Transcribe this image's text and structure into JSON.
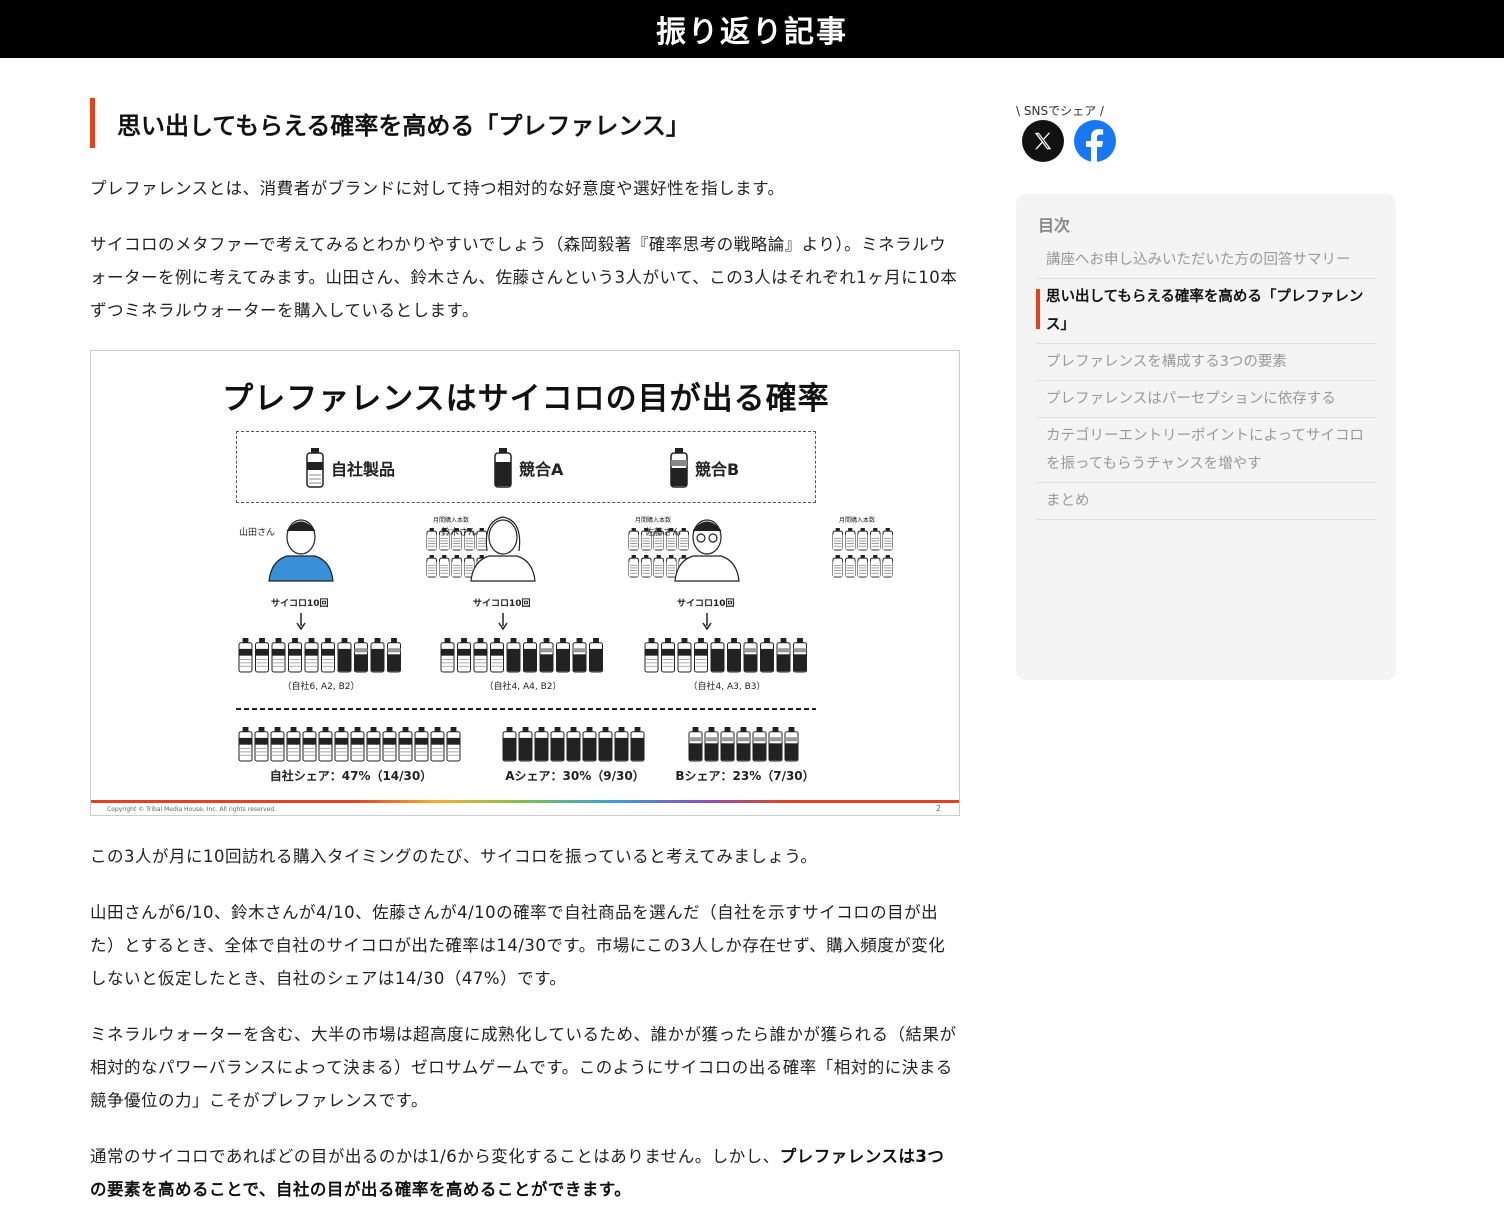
{
  "header": {
    "title": "振り返り記事"
  },
  "article": {
    "heading": "思い出してもらえる確率を高める「プレファレンス」",
    "p1": "プレファレンスとは、消費者がブランドに対して持つ相対的な好意度や選好性を指します。",
    "p2": "サイコロのメタファーで考えてみるとわかりやすいでしょう（森岡毅著『確率思考の戦略論』より）。ミネラルウォーターを例に考えてみます。山田さん、鈴木さん、佐藤さんという3人がいて、この3人はそれぞれ1ヶ月に10本ずつミネラルウォーターを購入しているとします。",
    "p3": "この3人が月に10回訪れる購入タイミングのたび、サイコロを振っていると考えてみましょう。",
    "p4": "山田さんが6/10、鈴木さんが4/10、佐藤さんが4/10の確率で自社商品を選んだ（自社を示すサイコロの目が出た）とするとき、全体で自社のサイコロが出た確率は14/30です。市場にこの3人しか存在せず、購入頻度が変化しないと仮定したとき、自社のシェアは14/30（47%）です。",
    "p5": "ミネラルウォーターを含む、大半の市場は超高度に成熟化しているため、誰かが獲ったら誰かが獲られる（結果が相対的なパワーバランスによって決まる）ゼロサムゲームです。このようにサイコロの出る確率「相対的に決まる競争優位の力」こそがプレファレンスです。",
    "p6_plain": "通常のサイコロであればどの目が出るのかは1/6から変化することはありません。しかし、",
    "p6_bold": "プレファレンスは3つの要素を高めることで、自社の目が出る確率を高めることができます。"
  },
  "figure": {
    "title": "プレファレンスはサイコロの目が出る確率",
    "legend": [
      "自社製品",
      "競合A",
      "競合B"
    ],
    "monthly_label": "月間購入本数",
    "dice_label": "サイコロ10回",
    "people": [
      {
        "name": "山田さん",
        "result": "（自社6, A2, B2）",
        "own": 6,
        "a": 2,
        "b": 2
      },
      {
        "name": "鈴木さん",
        "result": "（自社4, A4, B2）",
        "own": 4,
        "a": 4,
        "b": 2
      },
      {
        "name": "佐藤さん",
        "result": "（自社4, A3, B3）",
        "own": 4,
        "a": 3,
        "b": 3
      }
    ],
    "shares": [
      {
        "label": "自社シェア：47%（14/30）",
        "count": 14,
        "kind": "own"
      },
      {
        "label": "Aシェア：30%（9/30）",
        "count": 9,
        "kind": "a"
      },
      {
        "label": "Bシェア：23%（7/30）",
        "count": 7,
        "kind": "b"
      }
    ],
    "copyright": "Copyright © Tribal Media House, Inc. All rights reserved.",
    "page": "2"
  },
  "sidebar": {
    "share_label": "\\ SNSでシェア /",
    "toc_title": "目次",
    "toc": [
      {
        "label": "講座へお申し込みいただいた方の回答サマリー",
        "active": false
      },
      {
        "label": "思い出してもらえる確率を高める「プレファレンス」",
        "active": true
      },
      {
        "label": "プレファレンスを構成する3つの要素",
        "active": false
      },
      {
        "label": "プレファレンスはパーセプションに依存する",
        "active": false
      },
      {
        "label": "カテゴリーエントリーポイントによってサイコロを振ってもらうチャンスを増やす",
        "active": false
      },
      {
        "label": "まとめ",
        "active": false
      }
    ]
  }
}
